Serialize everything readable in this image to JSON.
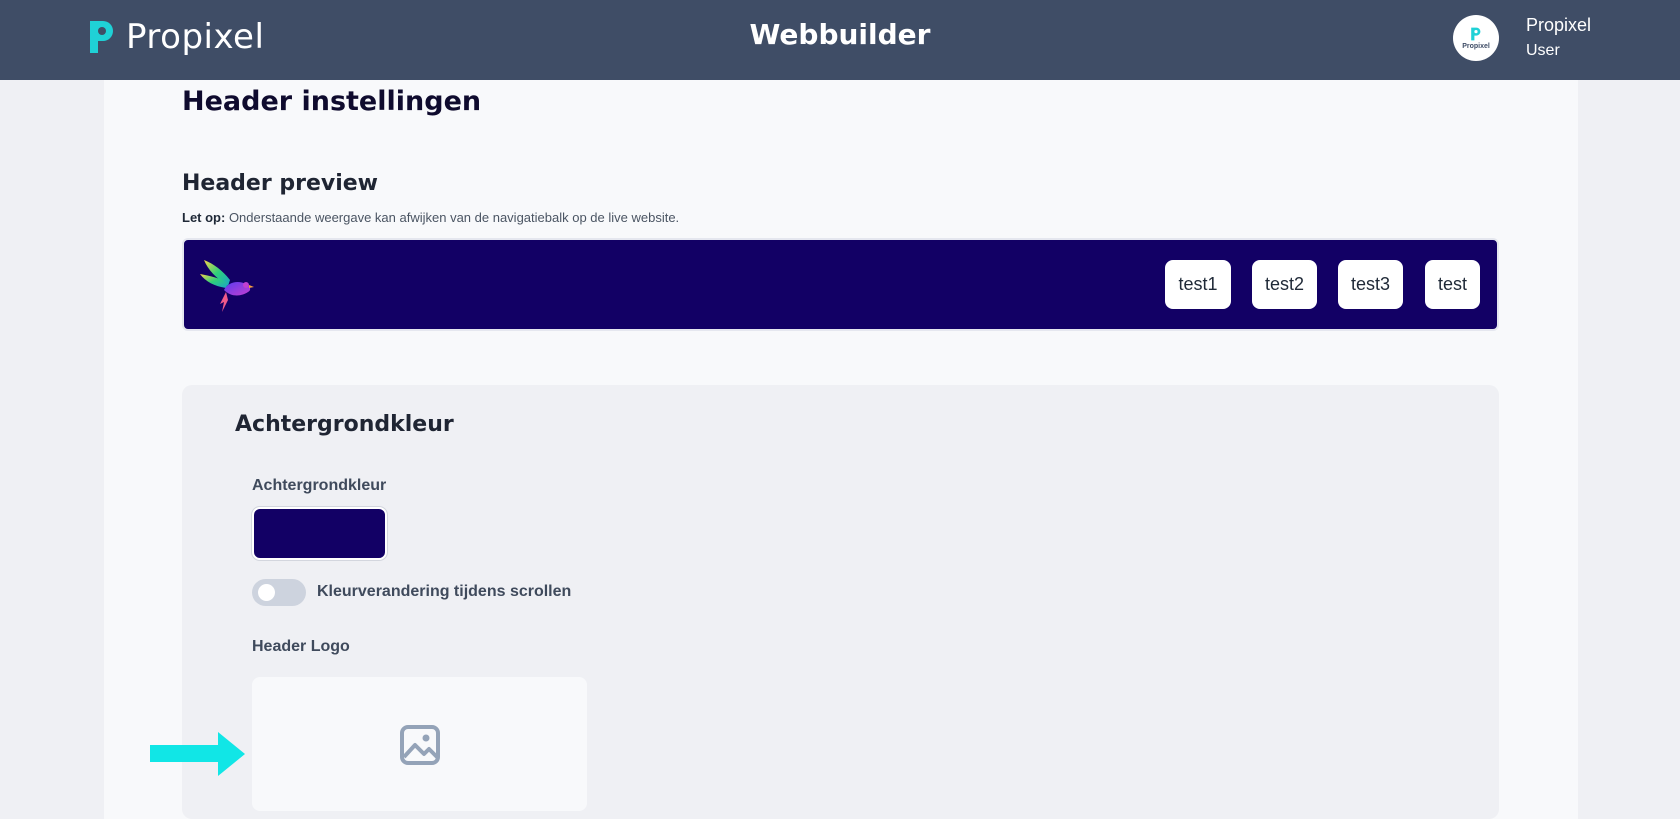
{
  "header": {
    "brand_name": "Propixel",
    "app_title": "Webbuilder",
    "avatar_text": "Propixel",
    "user_name": "Propixel",
    "user_role": "User",
    "brand_color": "#1fd1d6",
    "bar_color": "#3f4d66"
  },
  "page": {
    "title": "Header instellingen",
    "preview_section_title": "Header preview",
    "notice_label": "Let op:",
    "notice_text": " Onderstaande weergave kan afwijken van de navigatiebalk op de live website."
  },
  "preview": {
    "background_color": "#120065",
    "logo_icon": "bird-logo-icon",
    "nav_items": [
      "test1",
      "test2",
      "test3",
      "test"
    ]
  },
  "settings": {
    "card_title": "Achtergrondkleur",
    "bg_color_label": "Achtergrondkleur",
    "bg_color_value": "#120065",
    "scroll_toggle_label": "Kleurverandering tijdens scrollen",
    "scroll_toggle_on": false,
    "logo_label": "Header Logo",
    "upload_icon": "image-icon",
    "pointer_icon": "arrow-right-icon",
    "pointer_color": "#11e6e6"
  }
}
